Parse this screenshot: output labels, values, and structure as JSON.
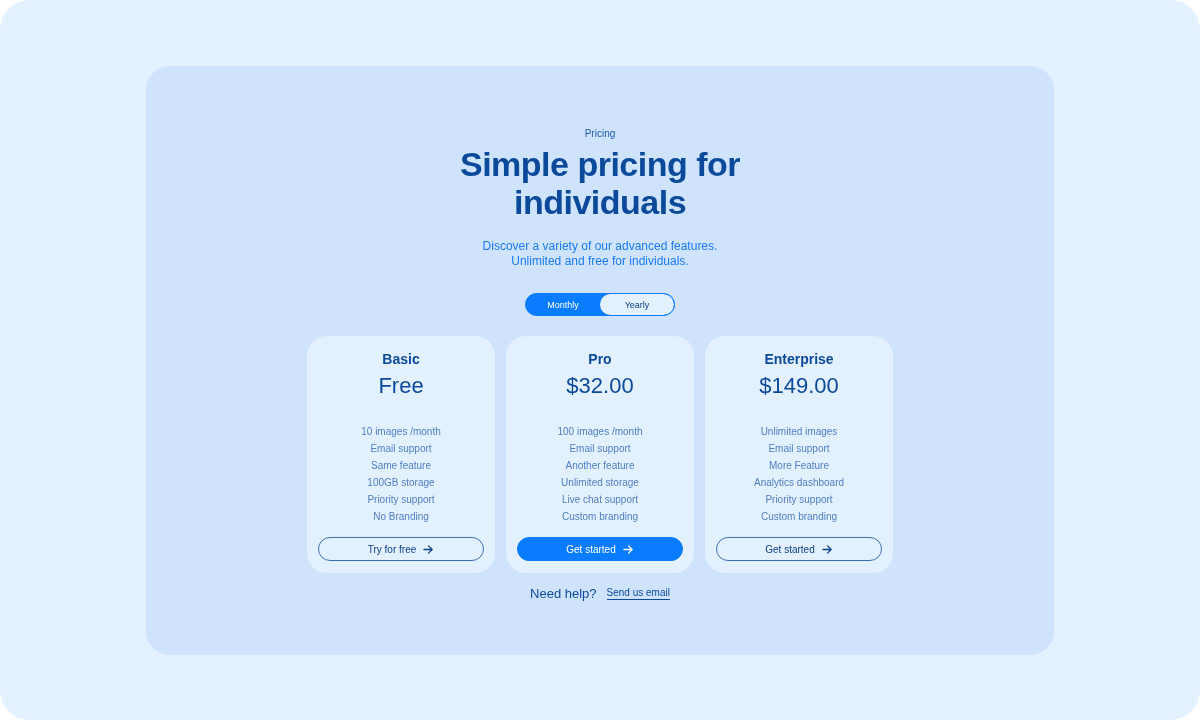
{
  "eyebrow": "Pricing",
  "title": "Simple pricing for individuals",
  "subtitle": [
    "Discover a variety of our advanced features.",
    "Unlimited and free for individuals."
  ],
  "billing_toggle": [
    {
      "label": "Monthly",
      "selected": true
    },
    {
      "label": "Yearly",
      "selected": false
    }
  ],
  "plans": [
    {
      "name": "Basic",
      "price": "Free",
      "features": [
        "10 images /month",
        "Email support",
        "Same feature",
        "100GB storage",
        "Priority support",
        "No Branding"
      ],
      "button": {
        "label": "Try for free",
        "kind": "outline"
      }
    },
    {
      "name": "Pro",
      "price": "$32.00",
      "features": [
        "100 images /month",
        "Email support",
        "Another feature",
        "Unlimited storage",
        "Live chat support",
        "Custom branding"
      ],
      "button": {
        "label": "Get started",
        "kind": "primary"
      }
    },
    {
      "name": "Enterprise",
      "price": "$149.00",
      "features": [
        "Unlimited images",
        "Email support",
        "More Feature",
        "Analytics dashboard",
        "Priority support",
        "Custom branding"
      ],
      "button": {
        "label": "Get started",
        "kind": "outline"
      }
    }
  ],
  "help": {
    "text": "Need help?",
    "link": "Send us email"
  }
}
